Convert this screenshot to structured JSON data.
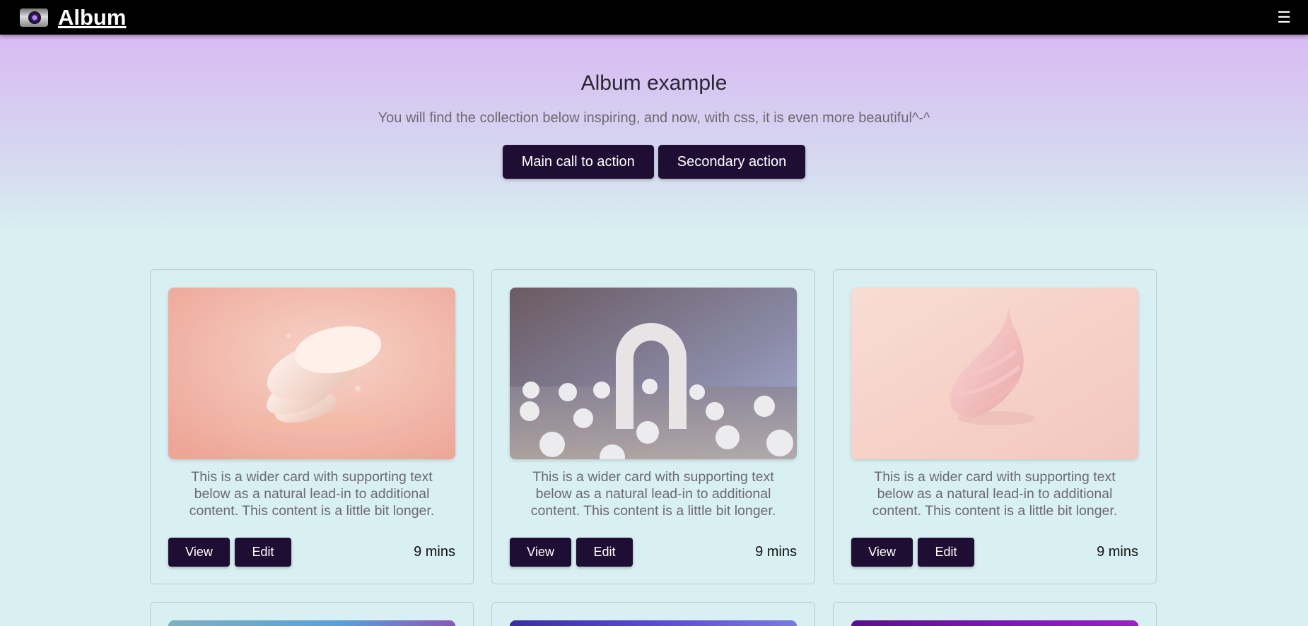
{
  "navbar": {
    "brand": "Album",
    "logo_icon": "camera-logo-icon",
    "menu_icon": "☰"
  },
  "hero": {
    "title": "Album example",
    "lead": "You will find the collection below inspiring, and now, with css, it is even more beautiful^-^",
    "primary_button": "Main call to action",
    "secondary_button": "Secondary action"
  },
  "cards": [
    {
      "image": "peach-layered-sculpture",
      "text": "This is a wider card with supporting text below as a natural lead-in to additional content. This content is a little bit longer.",
      "view": "View",
      "edit": "Edit",
      "time": "9 mins"
    },
    {
      "image": "white-arch-with-spheres",
      "text": "This is a wider card with supporting text below as a natural lead-in to additional content. This content is a little bit longer.",
      "view": "View",
      "edit": "Edit",
      "time": "9 mins"
    },
    {
      "image": "pink-swirl-sculpture",
      "text": "This is a wider card with supporting text below as a natural lead-in to additional content. This content is a little bit longer.",
      "view": "View",
      "edit": "Edit",
      "time": "9 mins"
    }
  ],
  "colors": {
    "navbar": "#000000",
    "button": "#1f0e33",
    "page_bg": "#d9f0f2",
    "hero_top": "#d8baf2"
  }
}
